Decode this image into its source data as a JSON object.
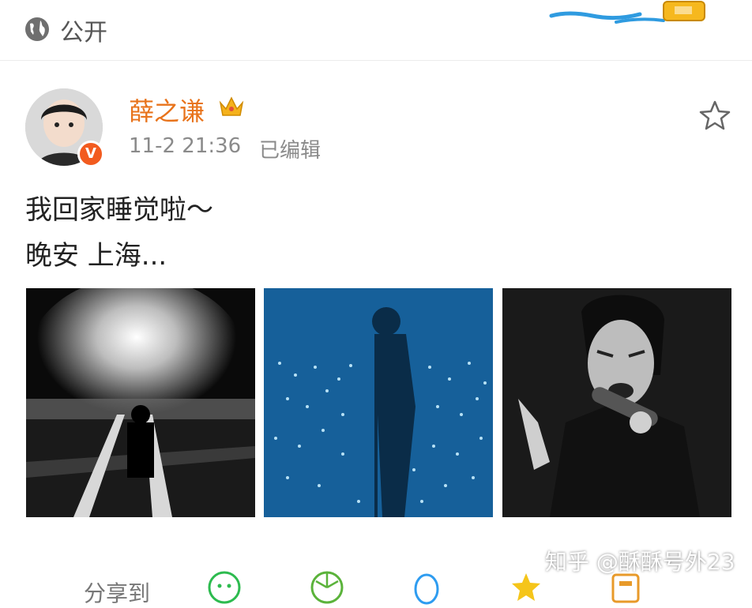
{
  "header": {
    "visibility": "公开",
    "visibility_icon": "globe-icon"
  },
  "author": {
    "name": "薛之谦",
    "badge_icon": "crown-icon",
    "verified_badge": "V",
    "timestamp": "11-2 21:36",
    "edited": "已编辑"
  },
  "post": {
    "lines": [
      "我回家睡觉啦～",
      "晚安 上海..."
    ]
  },
  "photos": [
    "concert-stage-bw",
    "concert-silhouette-blue",
    "singer-bw-closeup"
  ],
  "share": {
    "label": "分享到"
  },
  "watermark": "知乎 @酥酥号外23",
  "colors": {
    "name": "#e8731b",
    "verified": "#f25b1f",
    "meta": "#8a8a8a"
  }
}
